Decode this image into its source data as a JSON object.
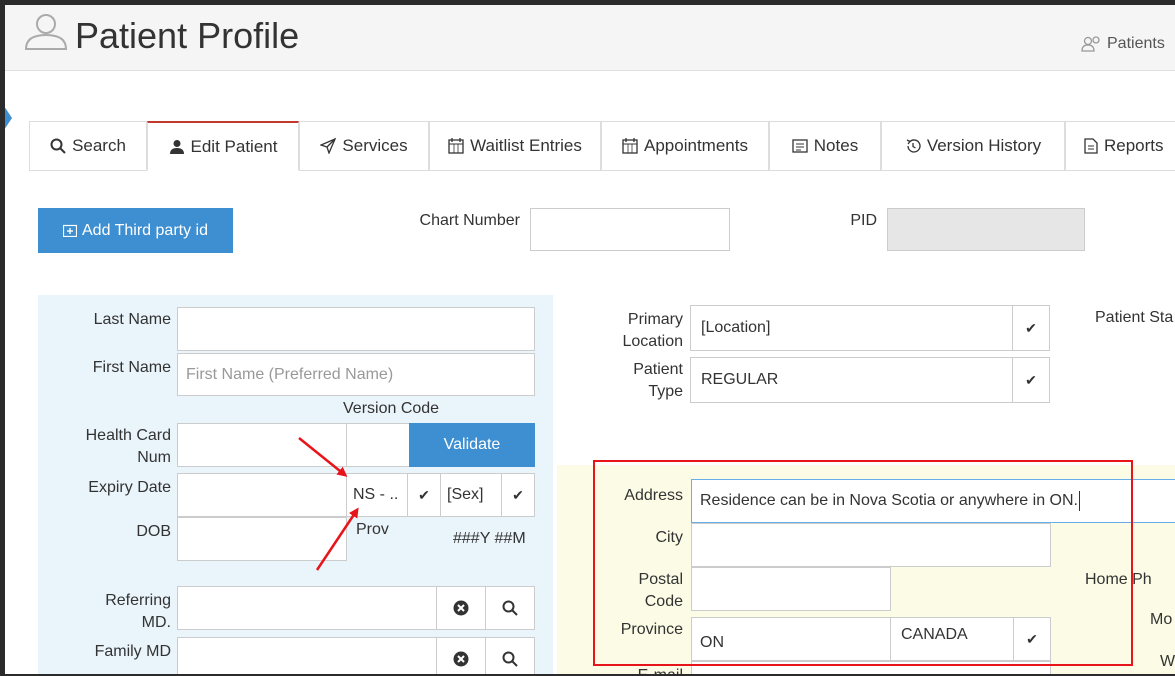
{
  "header": {
    "title": "Patient Profile",
    "right_link": "Patients"
  },
  "tabs": [
    {
      "label": "Search",
      "icon": "search-icon"
    },
    {
      "label": "Edit Patient",
      "icon": "user-icon"
    },
    {
      "label": "Services",
      "icon": "send-icon"
    },
    {
      "label": "Waitlist Entries",
      "icon": "calendar-icon"
    },
    {
      "label": "Appointments",
      "icon": "calendar-icon"
    },
    {
      "label": "Notes",
      "icon": "notes-icon"
    },
    {
      "label": "Version History",
      "icon": "history-icon"
    },
    {
      "label": "Reports",
      "icon": "document-icon"
    }
  ],
  "toolbar": {
    "add_third_party": "Add Third party id",
    "chart_number_label": "Chart Number",
    "chart_number_value": "",
    "pid_label": "PID",
    "pid_value": ""
  },
  "left_form": {
    "last_name_label": "Last Name",
    "last_name_value": "",
    "first_name_label": "First Name",
    "first_name_placeholder": "First Name (Preferred Name)",
    "version_code_label": "Version Code",
    "health_card_label_1": "Health Card",
    "health_card_label_2": "Num",
    "validate_label": "Validate",
    "expiry_label": "Expiry Date",
    "prov_value": "NS - ..",
    "sex_value": "[Sex]",
    "dob_label": "DOB",
    "prov_label": "Prov",
    "age_format": "###Y ##M",
    "referring_label_1": "Referring",
    "referring_label_2": "MD.",
    "family_md_label": "Family MD"
  },
  "right_form": {
    "primary_location_label_1": "Primary",
    "primary_location_label_2": "Location",
    "primary_location_value": "[Location]",
    "patient_type_label_1": "Patient",
    "patient_type_label_2": "Type",
    "patient_type_value": "REGULAR",
    "patient_status_label": "Patient Sta",
    "address_label": "Address",
    "address_value": "Residence can be in Nova Scotia or anywhere in ON.",
    "city_label": "City",
    "city_value": "",
    "postal_label_1": "Postal",
    "postal_label_2": "Code",
    "province_label": "Province",
    "province_value": "ON",
    "country_value": "CANADA",
    "home_phone_label": "Home Ph",
    "mobile_label": "Mo",
    "work_label": "W",
    "email_label": "E-mail"
  },
  "colors": {
    "accent_blue": "#3d8fd1",
    "left_panel_bg": "#eaf4fb",
    "address_bg": "#fbfbe6",
    "annotation_red": "#e8141b",
    "active_tab_border": "#c0392b"
  }
}
